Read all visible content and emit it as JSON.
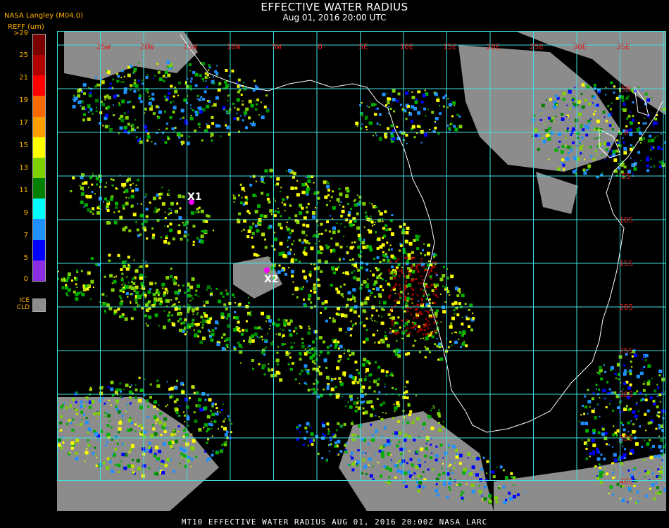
{
  "header": {
    "title": "EFFECTIVE WATER RADIUS",
    "subtitle": "Aug 01, 2016 20:00 UTC",
    "source": "NASA Langley (M04.0)"
  },
  "legend": {
    "title": "REFF (um)",
    "ticks": [
      ">29",
      "25",
      "21",
      "19",
      "17",
      "15",
      "13",
      "11",
      "9",
      "7",
      "5",
      "0"
    ],
    "colors": [
      "#7a0000",
      "#b00000",
      "#ff0000",
      "#ff6a00",
      "#ff9f00",
      "#ffff00",
      "#7fd000",
      "#008000",
      "#00ffff",
      "#1e90ff",
      "#0000ff",
      "#8b2be2"
    ],
    "ice_label_1": "ICE",
    "ice_label_2": "CLD",
    "ice_color": "#8c8c8c"
  },
  "map": {
    "lon_labels": [
      "25W",
      "20W",
      "15W",
      "10W",
      "5W",
      "0",
      "5E",
      "10E",
      "15E",
      "20E",
      "25E",
      "30E",
      "35E"
    ],
    "lat_labels": [
      "5N",
      "0",
      "5S",
      "10S",
      "15S",
      "20S",
      "25S",
      "30S",
      "35S",
      "40S"
    ],
    "grid_color": "#40e0e0",
    "coast_color": "#ffffff",
    "markers": [
      {
        "label": "X1",
        "color": "#ff00ff"
      },
      {
        "label": "X2",
        "color": "#ff00ff"
      }
    ]
  },
  "footer": {
    "text": "MT10  EFFECTIVE WATER RADIUS  AUG 01, 2016 20:00Z  NASA LARC"
  }
}
